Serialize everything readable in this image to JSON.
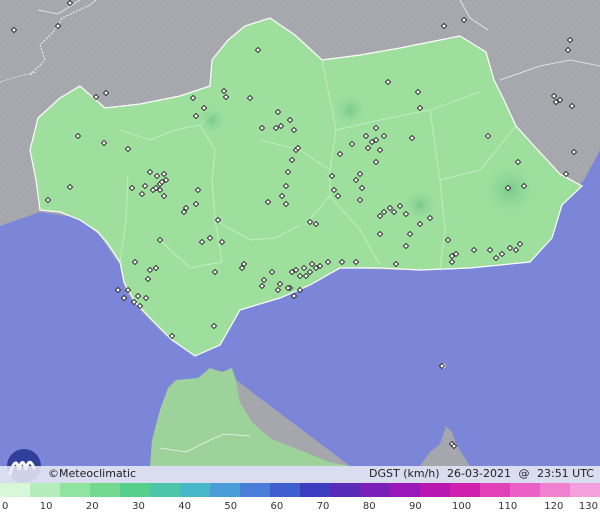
{
  "footer": {
    "brand": "©Meteoclimatic",
    "variable": "DGST (km/h)",
    "date": "26-03-2021",
    "separator": "@",
    "time": "23:51 UTC"
  },
  "legend": {
    "ticks": [
      "0",
      "10",
      "20",
      "30",
      "40",
      "50",
      "60",
      "70",
      "80",
      "90",
      "100",
      "110",
      "120",
      "130"
    ],
    "colors": [
      "#d8f6d8",
      "#b4edbc",
      "#8fe4a0",
      "#72d98f",
      "#57cf8c",
      "#4cc6a8",
      "#47b8c8",
      "#4a9ed8",
      "#4a7ed8",
      "#3f5fd0",
      "#3c3cc0",
      "#5a2bb8",
      "#7a1fb8",
      "#9a18b8",
      "#b818b0",
      "#d020b0",
      "#e040b8",
      "#ea60c4",
      "#f080d0",
      "#f4a0dc"
    ]
  },
  "colors": {
    "sea": "#7c86d8",
    "land_other": "#a6a7ad",
    "region": "#9edf9e",
    "africa": "#9ed29b",
    "station": "#ffffff"
  },
  "stations": [
    [
      14,
      30
    ],
    [
      58,
      26
    ],
    [
      70,
      3
    ],
    [
      258,
      50
    ],
    [
      193,
      98
    ],
    [
      196,
      116
    ],
    [
      204,
      108
    ],
    [
      250,
      98
    ],
    [
      224,
      91
    ],
    [
      226,
      97
    ],
    [
      276,
      128
    ],
    [
      281,
      126
    ],
    [
      290,
      120
    ],
    [
      278,
      112
    ],
    [
      262,
      128
    ],
    [
      96,
      97
    ],
    [
      106,
      93
    ],
    [
      78,
      136
    ],
    [
      104,
      143
    ],
    [
      128,
      149
    ],
    [
      132,
      188
    ],
    [
      145,
      186
    ],
    [
      150,
      172
    ],
    [
      153,
      190
    ],
    [
      156,
      188
    ],
    [
      160,
      184
    ],
    [
      162,
      182
    ],
    [
      164,
      174
    ],
    [
      160,
      190
    ],
    [
      157,
      176
    ],
    [
      70,
      187
    ],
    [
      48,
      200
    ],
    [
      142,
      194
    ],
    [
      184,
      212
    ],
    [
      186,
      208
    ],
    [
      196,
      204
    ],
    [
      198,
      190
    ],
    [
      210,
      238
    ],
    [
      202,
      242
    ],
    [
      218,
      220
    ],
    [
      215,
      272
    ],
    [
      244,
      264
    ],
    [
      242,
      268
    ],
    [
      214,
      326
    ],
    [
      172,
      336
    ],
    [
      124,
      298
    ],
    [
      138,
      296
    ],
    [
      134,
      302
    ],
    [
      140,
      306
    ],
    [
      146,
      298
    ],
    [
      150,
      270
    ],
    [
      148,
      279
    ],
    [
      156,
      268
    ],
    [
      135,
      262
    ],
    [
      118,
      290
    ],
    [
      128,
      290
    ],
    [
      160,
      240
    ],
    [
      294,
      130
    ],
    [
      296,
      150
    ],
    [
      292,
      160
    ],
    [
      286,
      186
    ],
    [
      288,
      172
    ],
    [
      298,
      148
    ],
    [
      282,
      196
    ],
    [
      268,
      202
    ],
    [
      272,
      272
    ],
    [
      264,
      280
    ],
    [
      262,
      286
    ],
    [
      280,
      284
    ],
    [
      278,
      290
    ],
    [
      290,
      288
    ],
    [
      292,
      272
    ],
    [
      296,
      270
    ],
    [
      300,
      276
    ],
    [
      304,
      268
    ],
    [
      306,
      276
    ],
    [
      310,
      272
    ],
    [
      312,
      264
    ],
    [
      316,
      268
    ],
    [
      320,
      266
    ],
    [
      328,
      262
    ],
    [
      342,
      262
    ],
    [
      356,
      262
    ],
    [
      294,
      296
    ],
    [
      288,
      288
    ],
    [
      300,
      290
    ],
    [
      310,
      222
    ],
    [
      316,
      224
    ],
    [
      286,
      204
    ],
    [
      332,
      176
    ],
    [
      334,
      190
    ],
    [
      338,
      196
    ],
    [
      340,
      154
    ],
    [
      352,
      144
    ],
    [
      356,
      180
    ],
    [
      360,
      174
    ],
    [
      362,
      188
    ],
    [
      360,
      200
    ],
    [
      366,
      136
    ],
    [
      368,
      148
    ],
    [
      372,
      142
    ],
    [
      376,
      140
    ],
    [
      380,
      150
    ],
    [
      376,
      128
    ],
    [
      384,
      136
    ],
    [
      376,
      162
    ],
    [
      388,
      82
    ],
    [
      418,
      92
    ],
    [
      420,
      108
    ],
    [
      400,
      206
    ],
    [
      394,
      212
    ],
    [
      390,
      208
    ],
    [
      380,
      216
    ],
    [
      384,
      212
    ],
    [
      380,
      234
    ],
    [
      396,
      264
    ],
    [
      406,
      246
    ],
    [
      410,
      234
    ],
    [
      406,
      214
    ],
    [
      420,
      224
    ],
    [
      430,
      218
    ],
    [
      448,
      240
    ],
    [
      452,
      256
    ],
    [
      456,
      254
    ],
    [
      452,
      262
    ],
    [
      474,
      250
    ],
    [
      490,
      250
    ],
    [
      496,
      258
    ],
    [
      502,
      254
    ],
    [
      510,
      248
    ],
    [
      516,
      250
    ],
    [
      520,
      244
    ],
    [
      508,
      188
    ],
    [
      524,
      186
    ],
    [
      518,
      162
    ],
    [
      566,
      174
    ],
    [
      574,
      152
    ],
    [
      570,
      40
    ],
    [
      568,
      50
    ],
    [
      560,
      100
    ],
    [
      554,
      96
    ],
    [
      556,
      102
    ],
    [
      572,
      106
    ],
    [
      488,
      136
    ],
    [
      412,
      138
    ],
    [
      444,
      26
    ],
    [
      464,
      20
    ],
    [
      442,
      366
    ],
    [
      452,
      444
    ],
    [
      454,
      446
    ],
    [
      222,
      242
    ],
    [
      164,
      196
    ],
    [
      166,
      180
    ]
  ]
}
